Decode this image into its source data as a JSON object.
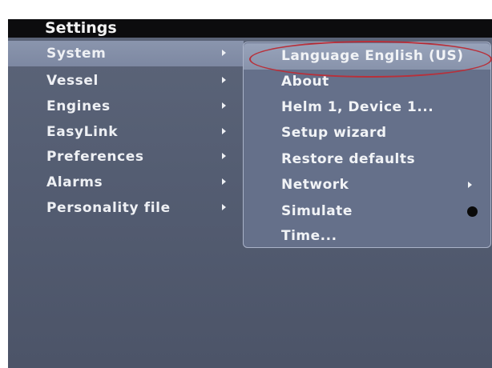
{
  "window": {
    "title": "Settings"
  },
  "menu": {
    "items": [
      {
        "label": "System",
        "selected": true,
        "has_submenu": true
      },
      {
        "label": "Vessel",
        "selected": false,
        "has_submenu": true
      },
      {
        "label": "Engines",
        "selected": false,
        "has_submenu": true
      },
      {
        "label": "EasyLink",
        "selected": false,
        "has_submenu": true
      },
      {
        "label": "Preferences",
        "selected": false,
        "has_submenu": true
      },
      {
        "label": "Alarms",
        "selected": false,
        "has_submenu": true
      },
      {
        "label": "Personality file",
        "selected": false,
        "has_submenu": true
      }
    ]
  },
  "submenu": {
    "items": [
      {
        "label": "Language English (US)",
        "selected": true
      },
      {
        "label": "About"
      },
      {
        "label": "Helm 1, Device 1..."
      },
      {
        "label": "Setup wizard"
      },
      {
        "label": "Restore defaults"
      },
      {
        "label": "Network",
        "has_submenu": true
      },
      {
        "label": "Simulate",
        "toggle": "radio-dot-icon",
        "checked": true
      },
      {
        "label": "Time..."
      }
    ]
  },
  "annotation": {
    "shape": "ellipse",
    "color": "#b8303a",
    "target": "Language English (US)"
  },
  "colors": {
    "background": "#5c6579",
    "title_bar": "#0c0c0e",
    "selected_row": "#8a95ad",
    "submenu_panel": "#65708a",
    "text": "#eef0f4"
  }
}
